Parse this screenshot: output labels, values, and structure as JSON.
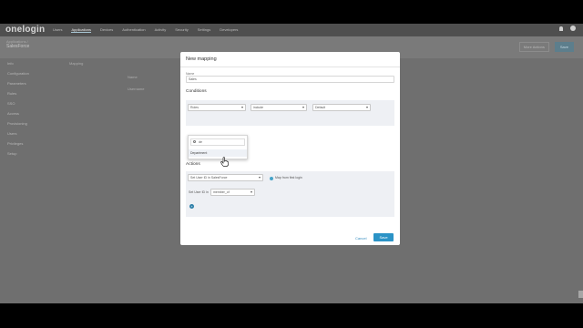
{
  "app": {
    "logo": "onelogin",
    "nav": [
      "Users",
      "Applications",
      "Devices",
      "Authentication",
      "Activity",
      "Security",
      "Settings",
      "Developers"
    ],
    "nav_active_index": 1,
    "breadcrumb": "Applications /",
    "title": "SalesForce",
    "more_actions": "More Actions",
    "save_label": "Save"
  },
  "sidebar": {
    "items": [
      "Info",
      "Configuration",
      "Parameters",
      "Rules",
      "SSO",
      "Access",
      "Provisioning",
      "Users",
      "Privileges",
      "Setup"
    ]
  },
  "behind": {
    "mapping_col": "Mapping",
    "col2": "Name",
    "row_hint": "Username"
  },
  "modal": {
    "title": "New mapping",
    "name_label": "Name",
    "name_value": "Sales",
    "conditions_title": "Conditions",
    "condition": {
      "field_value": "Roles",
      "operator_value": "include",
      "value_value": "Default"
    },
    "dropdown": {
      "search_value": "de",
      "option": "Department"
    },
    "actions_title": "Actions",
    "action": {
      "select_value": "Set User ID in SalesForce",
      "radio_label": "Map from first login",
      "inline_label": "Set User ID in",
      "inline_select_value": "member_of"
    },
    "cancel_label": "Cancel",
    "save_label": "Save"
  },
  "colors": {
    "accent": "#2b93c6",
    "overlay": "#6f6f6f"
  }
}
